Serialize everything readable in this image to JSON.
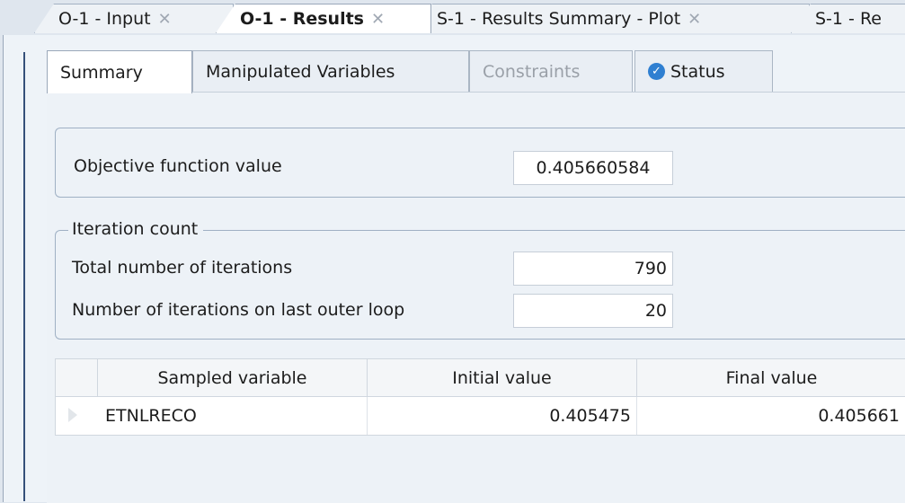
{
  "doc_tabs": [
    {
      "label": "O-1 - Input",
      "active": false
    },
    {
      "label": "O-1 - Results",
      "active": true
    },
    {
      "label": "S-1 - Results Summary - Plot",
      "active": false
    },
    {
      "label": "S-1 - Re",
      "active": false
    }
  ],
  "sub_tabs": [
    {
      "label": "Summary",
      "state": "active"
    },
    {
      "label": "Manipulated Variables",
      "state": "normal"
    },
    {
      "label": "Constraints",
      "state": "disabled"
    },
    {
      "label": "Status",
      "state": "normal",
      "icon": "check-circle-icon"
    }
  ],
  "objective": {
    "label": "Objective function value",
    "value": "0.405660584"
  },
  "iteration": {
    "group_label": "Iteration count",
    "total_label": "Total number of iterations",
    "total_value": "790",
    "last_loop_label": "Number of iterations on last outer loop",
    "last_loop_value": "20"
  },
  "table": {
    "columns": [
      "Sampled variable",
      "Initial value",
      "Final value"
    ],
    "rows": [
      {
        "variable": "ETNLRECO",
        "initial": "0.405475",
        "final": "0.405661"
      }
    ]
  },
  "colors": {
    "accent": "#2f7fd1",
    "border": "#9fb0c4"
  }
}
